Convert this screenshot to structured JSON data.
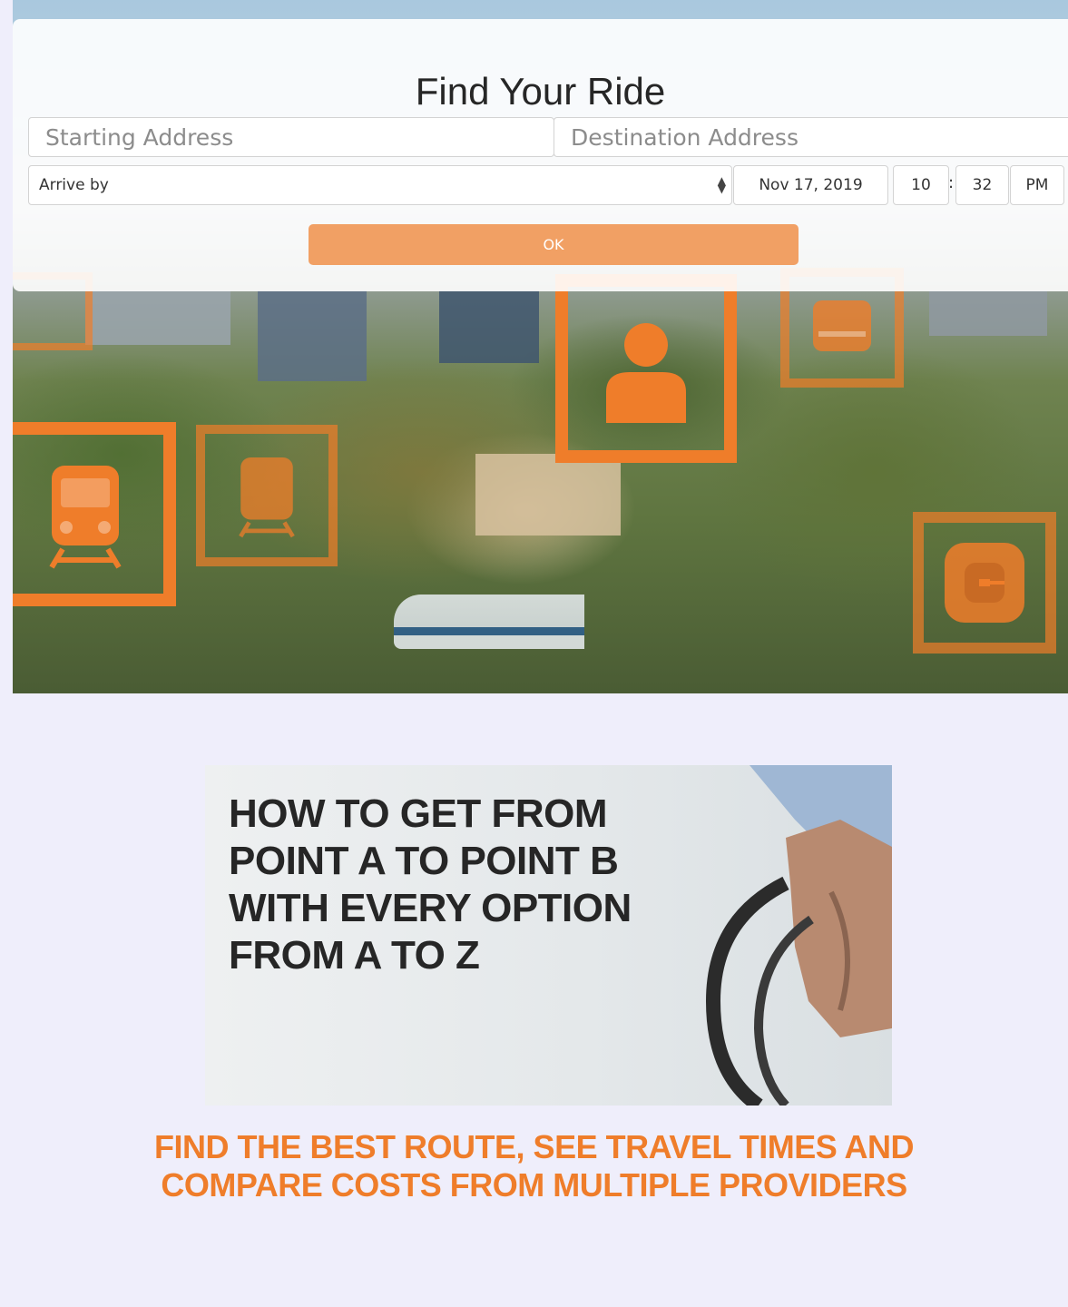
{
  "app": {
    "colors": {
      "accent": "#ef7d2a",
      "button": "#f1a064",
      "page_bg": "#efeefb"
    }
  },
  "hero": {
    "icons": [
      "train-icon",
      "train-icon",
      "person-icon",
      "bus-icon",
      "rideshare-icon",
      "building-icon"
    ]
  },
  "form": {
    "title": "Find Your Ride",
    "start": {
      "placeholder": "Starting Address",
      "value": ""
    },
    "destination": {
      "placeholder": "Destination Address",
      "value": ""
    },
    "mode": {
      "selected": "Arrive by"
    },
    "date": "Nov 17, 2019",
    "hour": "10",
    "separator": ":",
    "minute": "32",
    "ampm": "PM",
    "ok_label": "OK"
  },
  "promo": {
    "headline": "HOW TO GET FROM\nPOINT A TO POINT B\nWITH EVERY OPTION\nFROM A TO Z",
    "tagline_line1": "FIND THE BEST ROUTE, SEE TRAVEL TIMES AND",
    "tagline_line2": "COMPARE COSTS FROM MULTIPLE PROVIDERS"
  }
}
